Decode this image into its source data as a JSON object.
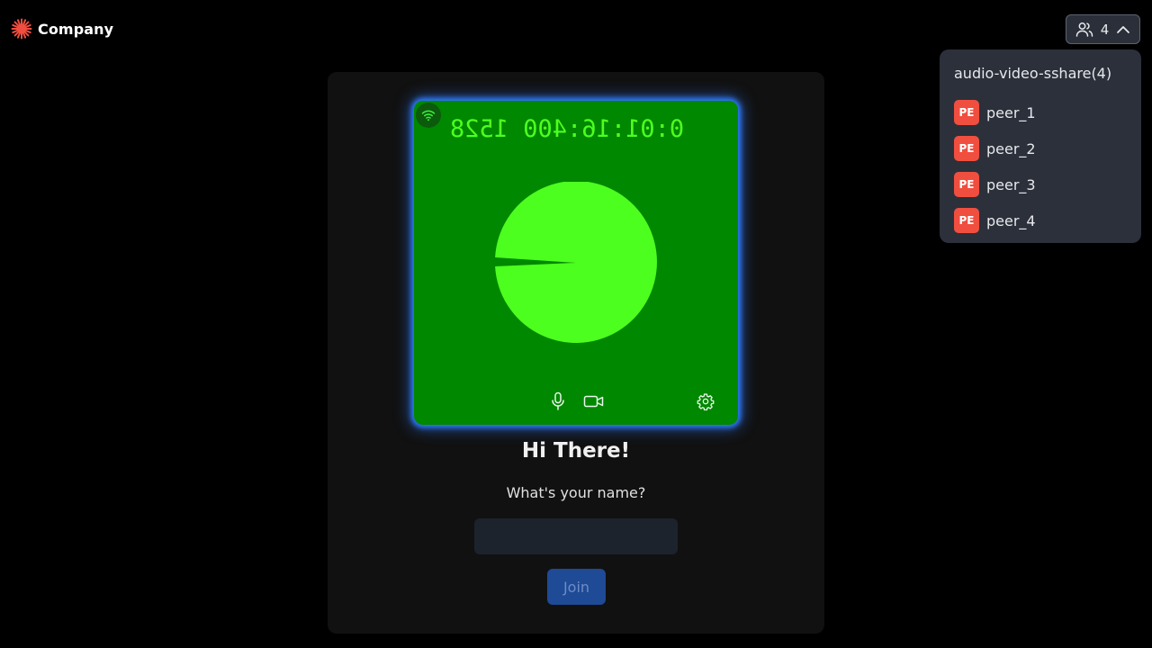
{
  "brand": {
    "name": "Company",
    "logo_icon": "sunburst-logo-icon",
    "accent": "#f04e3f"
  },
  "header": {
    "participants_count": "4",
    "participants_icon": "users-icon",
    "expand_icon": "chevron-up-icon"
  },
  "participants_panel": {
    "room_name": "audio-video-sshare(4)",
    "peers": [
      {
        "initials": "PE",
        "name": "peer_1"
      },
      {
        "initials": "PE",
        "name": "peer_2"
      },
      {
        "initials": "PE",
        "name": "peer_3"
      },
      {
        "initials": "PE",
        "name": "peer_4"
      }
    ]
  },
  "preview": {
    "timestamp": "0:01:16:400 1528",
    "network_icon": "wifi-icon",
    "controls": [
      "microphone-icon",
      "camera-icon",
      "settings-gear-icon"
    ],
    "colors": {
      "tile_bg": "#008800",
      "pie": "#4dff1f",
      "glow": "#2f7bff"
    }
  },
  "join_form": {
    "greeting": "Hi There!",
    "prompt": "What's your name?",
    "name_value": "",
    "name_placeholder": "",
    "join_label": "Join"
  }
}
